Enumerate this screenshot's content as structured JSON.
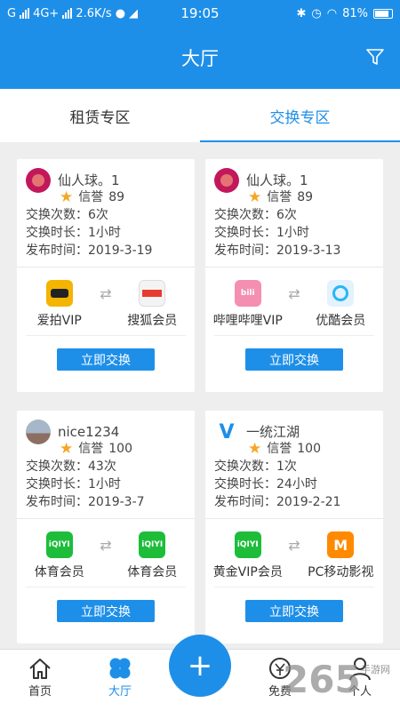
{
  "status_bar": {
    "carrier": "G",
    "network": "4G+",
    "speed": "2.6K/s",
    "time": "19:05",
    "battery": "81%"
  },
  "header": {
    "title": "大厅"
  },
  "tabs": [
    {
      "label": "租赁专区",
      "active": false
    },
    {
      "label": "交换专区",
      "active": true
    }
  ],
  "cards": [
    {
      "user": "仙人球。1",
      "credit_label": "信誉",
      "credit": "89",
      "count": "交换次数：6次",
      "duration": "交换时长：1小时",
      "date": "发布时间：2019-3-19",
      "app_from": {
        "name": "爱拍VIP",
        "icon": "aipai-icon",
        "color": "#f4b400"
      },
      "app_to": {
        "name": "搜狐会员",
        "icon": "sohu-video-icon",
        "color": "#e83c2e"
      },
      "button": "立即交换"
    },
    {
      "user": "仙人球。1",
      "credit_label": "信誉",
      "credit": "89",
      "count": "交换次数：6次",
      "duration": "交换时长：1小时",
      "date": "发布时间：2019-3-13",
      "app_from": {
        "name": "哔哩哔哩VIP",
        "icon": "bilibili-icon",
        "color": "#f48fb1"
      },
      "app_to": {
        "name": "优酷会员",
        "icon": "youku-icon",
        "color": "#29b6f6"
      },
      "button": "立即交换"
    },
    {
      "user": "nice1234",
      "credit_label": "信誉",
      "credit": "100",
      "count": "交换次数：43次",
      "duration": "交换时长：1小时",
      "date": "发布时间：2019-3-7",
      "app_from": {
        "name": "体育会员",
        "icon": "iqiyi-icon",
        "color": "#1dbd3a"
      },
      "app_to": {
        "name": "体育会员",
        "icon": "iqiyi-icon",
        "color": "#1dbd3a"
      },
      "button": "立即交换"
    },
    {
      "user": "一统江湖",
      "credit_label": "信誉",
      "credit": "100",
      "count": "交换次数：1次",
      "duration": "交换时长：24小时",
      "date": "发布时间：2019-2-21",
      "app_from": {
        "name": "黄金VIP会员",
        "icon": "iqiyi-icon",
        "color": "#1dbd3a"
      },
      "app_to": {
        "name": "PC移动影视",
        "icon": "mango-tv-icon",
        "color": "#ff8a00"
      },
      "button": "立即交换"
    }
  ],
  "bottom_nav": [
    {
      "label": "首页",
      "icon": "home-icon"
    },
    {
      "label": "大厅",
      "icon": "clover-icon",
      "active": true
    },
    {
      "label": "免费",
      "icon": "free-icon"
    },
    {
      "label": "个人",
      "icon": "person-icon"
    }
  ],
  "fab": {
    "label": "+"
  },
  "watermark": {
    "number": "265",
    "text": "手游网"
  },
  "colors": {
    "primary": "#1e8fe8",
    "star": "#f5a623"
  }
}
